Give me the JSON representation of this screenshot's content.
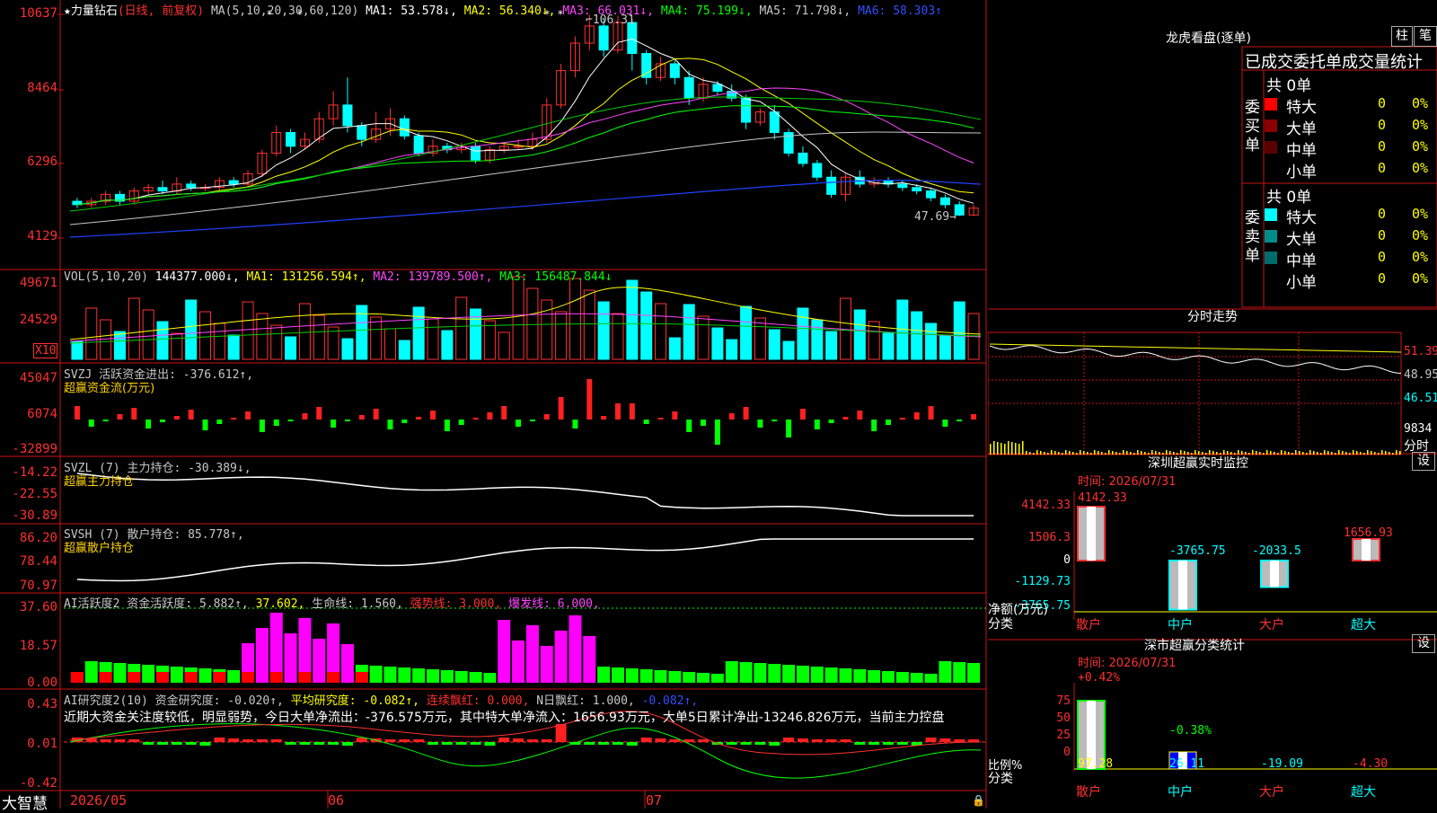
{
  "stock_header": {
    "name": "★力量钻石",
    "mode": "(日线, 前复权)",
    "ma_label": "MA(5,10,20,30,60,120)",
    "ma1": "MA1: 53.578↓,",
    "ma2": "MA2: 56.340↓,",
    "ma3": "MA3: 66.031↓,",
    "ma4": "MA4: 75.199↓,",
    "ma5": "MA5: 71.798↓,",
    "ma6": "MA6: 58.303↑"
  },
  "price_axis": [
    "10637",
    "8464",
    "6296",
    "4129"
  ],
  "price_annotations": {
    "high": "106.31",
    "low": "47.69"
  },
  "vol_header": {
    "label": "VOL(5,10,20)",
    "value": "144377.000↓,",
    "ma1": "MA1: 131256.594↑,",
    "ma2": "MA2: 139789.500↑,",
    "ma3": "MA3: 156487.844↓"
  },
  "vol_axis": [
    "49671",
    "24529"
  ],
  "vol_unit": "X10",
  "svzj": {
    "label": "SVZJ  活跃资金进出: -376.612↑,",
    "sub": "超赢资金流(万元)",
    "axis": [
      "45047",
      "6074",
      "-32899"
    ]
  },
  "svzl": {
    "label": "SVZL (7) 主力持仓: -30.389↓,",
    "sub": "超赢主力持仓",
    "axis": [
      "-14.22",
      "-22.55",
      "-30.89"
    ]
  },
  "svsh": {
    "label": "SVSH (7) 散户持仓: 85.778↑,",
    "sub": "超赢散户持仓",
    "axis": [
      "86.20",
      "78.44",
      "70.97"
    ]
  },
  "ai_active": {
    "label": "AI活跃度2 资金活跃度: 5.882↑,",
    "v2": "37.602,",
    "v3": "生命线: 1.560,",
    "v4": "强势线: 3.000,",
    "v5": "爆发线: 6.000,",
    "axis": [
      "37.60",
      "18.57",
      "0.00"
    ]
  },
  "ai_research": {
    "label": "AI研究度2(10) 资金研究度: -0.020↑,",
    "v2": "平均研究度: -0.082↑,",
    "v3": "连续飘红: 0.000,",
    "v4": "N日飘红: 1.000,",
    "v5": "-0.082↑,",
    "axis": [
      "0.43",
      "0.01",
      "-0.42"
    ],
    "commentary": "近期大资金关注度较低，明显弱势，今日大单净流出：-376.575万元，其中特大单净流入：1656.93万元，大单5日累计净出-13246.826万元，当前主力控盘"
  },
  "footer": {
    "brand": "大智慧",
    "dates": [
      "2026/05",
      "06",
      "07"
    ]
  },
  "lhb": {
    "title": "龙虎看盘(逐单)",
    "btn1": "柱",
    "btn2": "笔",
    "sub": "已成交委托单成交量统计",
    "buy": {
      "side": "委买单",
      "total": "共 0单",
      "rows": [
        {
          "name": "特大",
          "v": "0",
          "p": "0%",
          "c": "#ff0000"
        },
        {
          "name": "大单",
          "v": "0",
          "p": "0%",
          "c": "#8b0000"
        },
        {
          "name": "中单",
          "v": "0",
          "p": "0%",
          "c": "#5a0000"
        },
        {
          "name": "小单",
          "v": "0",
          "p": "0%",
          "c": "#000000"
        }
      ]
    },
    "sell": {
      "side": "委卖单",
      "total": "共 0单",
      "rows": [
        {
          "name": "特大",
          "v": "0",
          "p": "0%",
          "c": "#00ffff"
        },
        {
          "name": "大单",
          "v": "0",
          "p": "0%",
          "c": "#008b8b"
        },
        {
          "name": "中单",
          "v": "0",
          "p": "0%",
          "c": "#006b6b"
        },
        {
          "name": "小单",
          "v": "0",
          "p": "0%",
          "c": "#000000"
        }
      ]
    }
  },
  "fenshi": {
    "title": "分时走势",
    "axis": [
      "51.39",
      "48.95",
      "46.51",
      "9834"
    ],
    "unit": "分时"
  },
  "sz_monitor": {
    "title": "深圳超赢实时监控",
    "btn": "设",
    "time": "时间: 2026/07/31",
    "axis": [
      "4142.33",
      "1506.3",
      "0",
      "-1129.73",
      "-3765.75"
    ],
    "ylabel": "净额(万元)",
    "xlabel": "分类",
    "bars": [
      {
        "cat": "散户",
        "value": 4142.33,
        "label": "4142.33"
      },
      {
        "cat": "中户",
        "value": -3765.75,
        "label": "-3765.75"
      },
      {
        "cat": "大户",
        "value": -2033.5,
        "label": "-2033.5"
      },
      {
        "cat": "超大",
        "value": 1656.93,
        "label": "1656.93"
      }
    ]
  },
  "sz_class": {
    "title": "深市超赢分类统计",
    "btn": "设",
    "time": "时间: 2026/07/31",
    "axis": [
      "75",
      "50",
      "25",
      "0"
    ],
    "ylabel": "比例%",
    "xlabel": "分类",
    "top_labels": [
      "+0.42%",
      "-0.38%"
    ],
    "bottom_values": [
      "97.28",
      "26.11",
      "-19.09",
      "-4.30"
    ],
    "cats": [
      "散户",
      "中户",
      "大户",
      "超大"
    ]
  },
  "chart_data": [
    {
      "type": "candlestick",
      "title": "★力量钻石",
      "ylim": [
        41.29,
        106.37
      ],
      "high": 106.31,
      "low": 47.69,
      "series": [
        {
          "o": 52,
          "c": 51,
          "h": 53,
          "l": 50
        },
        {
          "o": 51,
          "c": 52,
          "h": 53,
          "l": 50
        },
        {
          "o": 52,
          "c": 54,
          "h": 55,
          "l": 51
        },
        {
          "o": 54,
          "c": 52,
          "h": 55,
          "l": 51
        },
        {
          "o": 52,
          "c": 55,
          "h": 56,
          "l": 51
        },
        {
          "o": 55,
          "c": 56,
          "h": 57,
          "l": 54
        },
        {
          "o": 56,
          "c": 55,
          "h": 58,
          "l": 54
        },
        {
          "o": 55,
          "c": 57,
          "h": 59,
          "l": 54
        },
        {
          "o": 57,
          "c": 56,
          "h": 58,
          "l": 55
        },
        {
          "o": 56,
          "c": 56,
          "h": 57,
          "l": 55
        },
        {
          "o": 56,
          "c": 58,
          "h": 59,
          "l": 55
        },
        {
          "o": 58,
          "c": 57,
          "h": 59,
          "l": 56
        },
        {
          "o": 57,
          "c": 60,
          "h": 61,
          "l": 56
        },
        {
          "o": 60,
          "c": 66,
          "h": 67,
          "l": 59
        },
        {
          "o": 66,
          "c": 72,
          "h": 74,
          "l": 65
        },
        {
          "o": 72,
          "c": 68,
          "h": 73,
          "l": 66
        },
        {
          "o": 68,
          "c": 70,
          "h": 72,
          "l": 67
        },
        {
          "o": 70,
          "c": 76,
          "h": 78,
          "l": 69
        },
        {
          "o": 76,
          "c": 80,
          "h": 84,
          "l": 74
        },
        {
          "o": 80,
          "c": 74,
          "h": 88,
          "l": 72
        },
        {
          "o": 74,
          "c": 70,
          "h": 75,
          "l": 68
        },
        {
          "o": 70,
          "c": 73,
          "h": 78,
          "l": 69
        },
        {
          "o": 73,
          "c": 76,
          "h": 79,
          "l": 71
        },
        {
          "o": 76,
          "c": 71,
          "h": 77,
          "l": 70
        },
        {
          "o": 71,
          "c": 66,
          "h": 72,
          "l": 65
        },
        {
          "o": 66,
          "c": 68,
          "h": 70,
          "l": 65
        },
        {
          "o": 68,
          "c": 67,
          "h": 69,
          "l": 66
        },
        {
          "o": 67,
          "c": 68,
          "h": 69,
          "l": 66
        },
        {
          "o": 68,
          "c": 64,
          "h": 69,
          "l": 63
        },
        {
          "o": 64,
          "c": 67,
          "h": 68,
          "l": 63
        },
        {
          "o": 67,
          "c": 68,
          "h": 69,
          "l": 66
        },
        {
          "o": 68,
          "c": 68,
          "h": 70,
          "l": 67
        },
        {
          "o": 68,
          "c": 70,
          "h": 72,
          "l": 67
        },
        {
          "o": 70,
          "c": 80,
          "h": 82,
          "l": 69
        },
        {
          "o": 80,
          "c": 90,
          "h": 92,
          "l": 79
        },
        {
          "o": 90,
          "c": 98,
          "h": 100,
          "l": 88
        },
        {
          "o": 98,
          "c": 103,
          "h": 106.31,
          "l": 96
        },
        {
          "o": 103,
          "c": 96,
          "h": 105,
          "l": 94
        },
        {
          "o": 96,
          "c": 104,
          "h": 106,
          "l": 95
        },
        {
          "o": 104,
          "c": 95,
          "h": 105,
          "l": 90
        },
        {
          "o": 95,
          "c": 88,
          "h": 96,
          "l": 86
        },
        {
          "o": 88,
          "c": 92,
          "h": 94,
          "l": 87
        },
        {
          "o": 92,
          "c": 88,
          "h": 93,
          "l": 86
        },
        {
          "o": 88,
          "c": 82,
          "h": 90,
          "l": 80
        },
        {
          "o": 82,
          "c": 86,
          "h": 88,
          "l": 81
        },
        {
          "o": 86,
          "c": 84,
          "h": 87,
          "l": 83
        },
        {
          "o": 84,
          "c": 82,
          "h": 86,
          "l": 81
        },
        {
          "o": 82,
          "c": 75,
          "h": 83,
          "l": 73
        },
        {
          "o": 75,
          "c": 78,
          "h": 79,
          "l": 74
        },
        {
          "o": 78,
          "c": 72,
          "h": 80,
          "l": 70
        },
        {
          "o": 72,
          "c": 66,
          "h": 73,
          "l": 65
        },
        {
          "o": 66,
          "c": 63,
          "h": 68,
          "l": 62
        },
        {
          "o": 63,
          "c": 59,
          "h": 64,
          "l": 58
        },
        {
          "o": 59,
          "c": 54,
          "h": 61,
          "l": 53
        },
        {
          "o": 54,
          "c": 59,
          "h": 60,
          "l": 52
        },
        {
          "o": 59,
          "c": 57,
          "h": 61,
          "l": 56
        },
        {
          "o": 57,
          "c": 58,
          "h": 59,
          "l": 56
        },
        {
          "o": 58,
          "c": 57,
          "h": 59,
          "l": 56
        },
        {
          "o": 57,
          "c": 56,
          "h": 58,
          "l": 55
        },
        {
          "o": 56,
          "c": 55,
          "h": 57,
          "l": 54
        },
        {
          "o": 55,
          "c": 53,
          "h": 56,
          "l": 52
        },
        {
          "o": 53,
          "c": 51,
          "h": 54,
          "l": 50
        },
        {
          "o": 51,
          "c": 48,
          "h": 52,
          "l": 47.69
        },
        {
          "o": 48,
          "c": 50,
          "h": 51,
          "l": 47.7
        }
      ]
    },
    {
      "type": "bar",
      "title": "VOL(5,10,20)",
      "ylim": [
        0,
        49671
      ]
    },
    {
      "type": "bar",
      "title": "SVZJ",
      "ylim": [
        -32899,
        45047
      ]
    },
    {
      "type": "line",
      "title": "SVZL",
      "ylim": [
        -30.89,
        -14.22
      ]
    },
    {
      "type": "line",
      "title": "SVSH",
      "ylim": [
        70.97,
        86.2
      ]
    },
    {
      "type": "bar",
      "title": "AI活跃度2",
      "ylim": [
        0,
        37.6
      ]
    },
    {
      "type": "bar",
      "title": "AI研究度2",
      "ylim": [
        -0.42,
        0.43
      ]
    }
  ]
}
